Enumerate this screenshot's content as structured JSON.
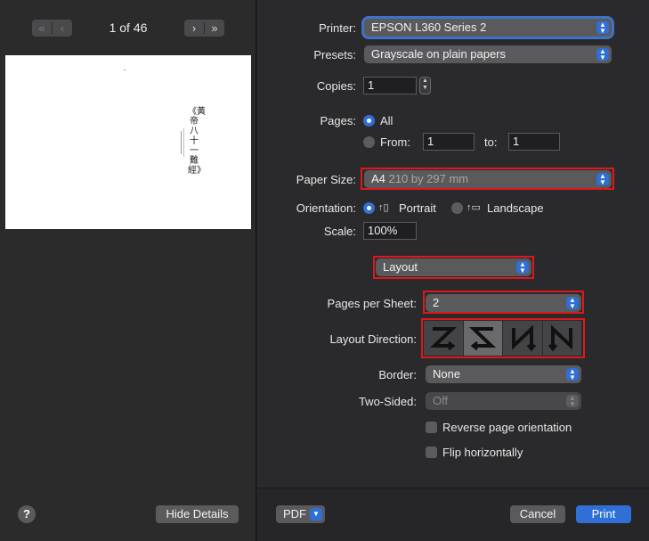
{
  "preview": {
    "first_page_icon": "double-chevron-left",
    "prev_page_icon": "chevron-left",
    "next_page_icon": "chevron-right",
    "last_page_icon": "double-chevron-right",
    "page_indicator": "1 of 46",
    "page_text": "《黃帝八十一難經》",
    "help_label": "?",
    "hide_details_label": "Hide Details"
  },
  "form": {
    "printer_label": "Printer:",
    "printer_value": "EPSON L360 Series 2",
    "presets_label": "Presets:",
    "presets_value": "Grayscale on plain papers",
    "copies_label": "Copies:",
    "copies_value": "1",
    "pages_label": "Pages:",
    "pages_all": "All",
    "pages_from": "From:",
    "pages_from_value": "1",
    "pages_to": "to:",
    "pages_to_value": "1",
    "paper_size_label": "Paper Size:",
    "paper_size_name": "A4",
    "paper_size_dims": "210 by 297 mm",
    "orientation_label": "Orientation:",
    "portrait_label": "Portrait",
    "landscape_label": "Landscape",
    "scale_label": "Scale:",
    "scale_value": "100%",
    "section_value": "Layout",
    "pages_per_sheet_label": "Pages per Sheet:",
    "pages_per_sheet_value": "2",
    "layout_direction_label": "Layout Direction:",
    "layout_directions": [
      "Z",
      "reverse-Z",
      "N-reverse",
      "N"
    ],
    "layout_direction_selected": "reverse-Z",
    "border_label": "Border:",
    "border_value": "None",
    "two_sided_label": "Two-Sided:",
    "two_sided_value": "Off",
    "reverse_orientation_label": "Reverse page orientation",
    "flip_horizontally_label": "Flip horizontally"
  },
  "footer": {
    "pdf_label": "PDF",
    "cancel_label": "Cancel",
    "print_label": "Print"
  },
  "colors": {
    "accent": "#2f6fd6",
    "highlight": "#e0181b"
  }
}
